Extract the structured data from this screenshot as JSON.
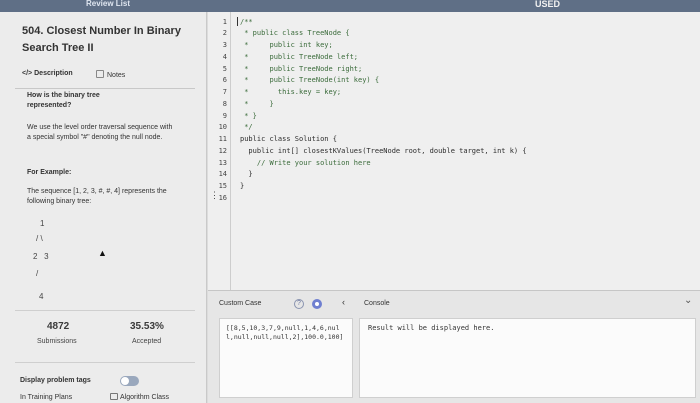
{
  "topbar": {
    "left_text": "Review List",
    "right_text": "USED"
  },
  "problem": {
    "title": "504. Closest Number In Binary Search Tree II",
    "tab_description": "Description",
    "tab_notes": "Notes",
    "heading": "How is the binary tree represented?",
    "paragraph": "We use the level order traversal sequence with a special symbol \"#\" denoting the null node.",
    "example_label": "For Example:",
    "example_text": "The sequence [1, 2, 3, #, #, 4] represents the following binary tree:",
    "tree": {
      "root": "1",
      "branches": "/ \\",
      "level2": "2   3",
      "branch3": "/",
      "level3": "4"
    }
  },
  "stats": {
    "submissions_value": "4872",
    "submissions_label": "Submissions",
    "accepted_value": "35.53%",
    "accepted_label": "Accepted"
  },
  "display_tags_label": "Display problem tags",
  "in_training_label": "In Training Plans",
  "algorithm_class_label": "Algorithm Class",
  "editor": {
    "line_numbers": [
      "1",
      "2",
      "3",
      "4",
      "5",
      "6",
      "7",
      "8",
      "9",
      "10",
      "11",
      "12",
      "13",
      "14",
      "15",
      "16"
    ],
    "lines": [
      "/**",
      " * public class TreeNode {",
      " *     public int key;",
      " *     public TreeNode left;",
      " *     public TreeNode right;",
      " *     public TreeNode(int key) {",
      " *       this.key = key;",
      " *     }",
      " * }",
      " */",
      "public class Solution {",
      "  public int[] closestKValues(TreeNode root, double target, int k) {",
      "    // Write your solution here",
      "  }",
      "}",
      ""
    ]
  },
  "console": {
    "custom_case_label": "Custom Case",
    "console_label": "Console",
    "input_value": "[[8,5,10,3,7,9,null,1,4,6,null,null,null,null,2],100.0,100]",
    "result_placeholder": "Result will be displayed here."
  },
  "colors": {
    "panel_bg": "#ececec",
    "editor_bg": "#efefef",
    "accent": "#5f6f86",
    "comment": "#3a6b3a"
  }
}
